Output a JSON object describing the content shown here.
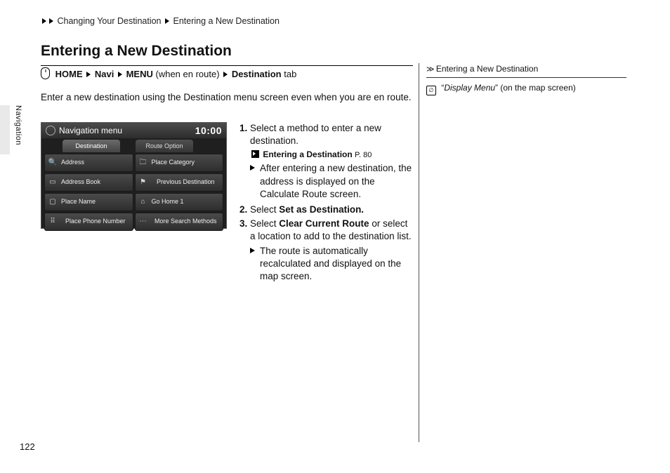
{
  "breadcrumb": {
    "level1": "Changing Your Destination",
    "level2": "Entering a New Destination"
  },
  "heading": "Entering a New Destination",
  "navpath": {
    "home": "HOME",
    "navi": "Navi",
    "menu": "MENU",
    "paren": "(when en route)",
    "dest": "Destination",
    "tab": "tab"
  },
  "intro": "Enter a new destination using the Destination menu screen even when you are en route.",
  "side_tab": "Navigation",
  "page_number": "122",
  "nav_menu": {
    "title": "Navigation menu",
    "clock": "10:00",
    "tabs": {
      "destination": "Destination",
      "route_option": "Route Option"
    },
    "items": {
      "address": "Address",
      "place_category": "Place Category",
      "address_book": "Address Book",
      "previous_destination": "Previous Destination",
      "place_name": "Place Name",
      "go_home": "Go Home 1",
      "place_phone": "Place Phone Number",
      "more_methods": "More Search Methods"
    }
  },
  "steps": {
    "s1": "Select a method to enter a new destination.",
    "s1_ref_label": "Entering a Destination",
    "s1_ref_page": "P. 80",
    "s1_arrow": "After entering a new destination, the address is displayed on the Calculate Route screen.",
    "s2_a": "Select ",
    "s2_b": "Set as Destination.",
    "s3_a": "Select ",
    "s3_b": "Clear Current Route",
    "s3_c": " or select a location to add to the destination list.",
    "s3_arrow": "The route is automatically recalculated and displayed on the map screen."
  },
  "sidebar": {
    "title": "Entering a New Destination",
    "voice_cmd": "Display Menu",
    "voice_suffix": " (on the map screen)"
  }
}
